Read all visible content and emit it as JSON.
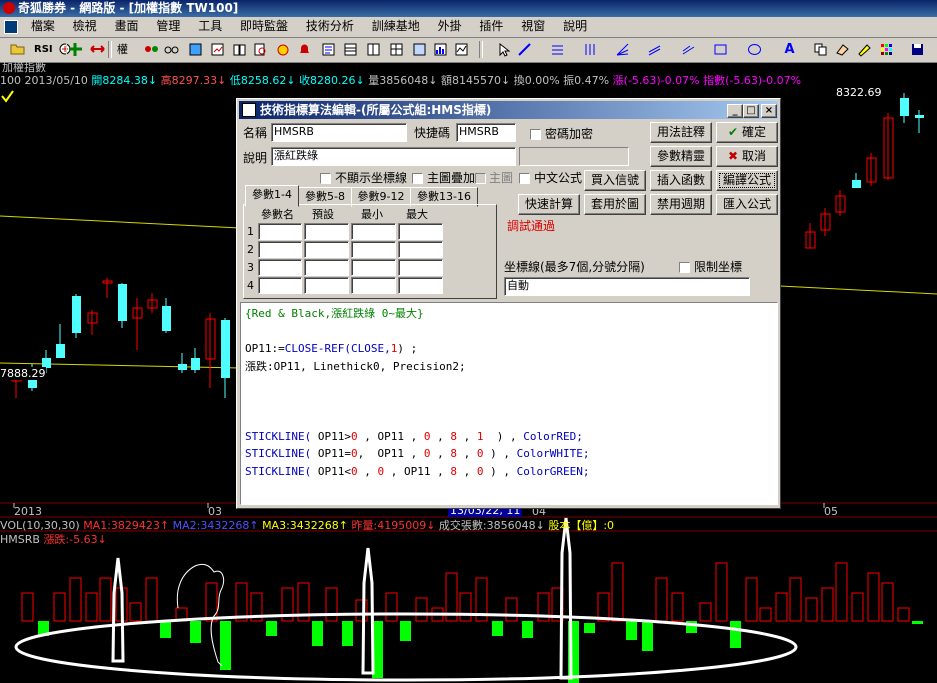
{
  "titlebar": {
    "title": "奇狐勝券 - 網路版 - [加權指數 TW100]"
  },
  "menu": {
    "items": [
      "檔案",
      "檢視",
      "畫面",
      "管理",
      "工具",
      "即時監盤",
      "技術分析",
      "訓練基地",
      "外掛",
      "插件",
      "視窗",
      "說明"
    ]
  },
  "toolbar": {
    "rsi_label": "RSI",
    "quan_label": "權"
  },
  "chart": {
    "title": "加權指數",
    "info": {
      "code": "100",
      "date": "2013/05/10",
      "open": "開8284.38↓",
      "high": "高8297.33↓",
      "low": "低8258.62↓",
      "close": "收8280.26↓",
      "volume": "量3856048↓",
      "amount": "額8145570↓",
      "turnover": "換0.00%",
      "amplitude": "振0.47%",
      "change": "漲(-5.63)-0.07%",
      "index": "指數(-5.63)-0.07%"
    },
    "price_label_high": "8322.69",
    "price_label_low": "7888.29",
    "date_labels": [
      "2013",
      "03",
      "04",
      "05"
    ],
    "cursor_label": "13/03/22, 11"
  },
  "vol_legend": {
    "name": "VOL(10,30,30)",
    "ma1": "MA1:3829423↑",
    "ma2": "MA2:3432268↑",
    "ma3": "MA3:3432268↑",
    "prev": "昨量:4195009↓",
    "deal": "成交張數:3856048↓",
    "share": "股本【億】:0"
  },
  "hms_legend": {
    "name": "HMSRB",
    "value": "漲跌:-5.63↓"
  },
  "dialog": {
    "title": "技術指標算法編輯-(所屬公式組:HMS指標)",
    "name_label": "名稱",
    "name_value": "HMSRB",
    "shortcut_label": "快捷碼",
    "shortcut_value": "HMSRB",
    "password_label": "密碼加密",
    "desc_label": "說明",
    "desc_value": "漲紅跌綠",
    "opt_no_axis": "不顯示坐標線",
    "opt_main_overlay": "主圖疊加",
    "opt_main": "主圖",
    "opt_chinese": "中文公式",
    "btn_usage": "用法註釋",
    "btn_ok": "確定",
    "btn_param_tune": "參數精靈",
    "btn_cancel": "取消",
    "btn_buy_signal": "買入信號",
    "btn_insert_func": "插入函數",
    "btn_compile": "編譯公式",
    "btn_quick_calc": "快速計算",
    "btn_apply_chart": "套用於圖",
    "btn_disable_period": "禁用週期",
    "btn_import": "匯入公式",
    "tabs": [
      "參數1-4",
      "參數5-8",
      "參數9-12",
      "參數13-16"
    ],
    "param_headers": [
      "參數名",
      "預設",
      "最小",
      "最大"
    ],
    "param_rows": [
      "1",
      "2",
      "3",
      "4"
    ],
    "status_text": "調試通過",
    "axis_label": "坐標線(最多7個,分號分隔)",
    "limit_label": "限制坐標",
    "axis_value": "自動",
    "code_lines": [
      [
        {
          "t": "{Red & Black,漲紅跌綠 0~最大}",
          "c": "green"
        }
      ],
      [
        {
          "t": "",
          "c": "black"
        }
      ],
      [
        {
          "t": "OP11:=",
          "c": "black"
        },
        {
          "t": "CLOSE-REF(CLOSE,",
          "c": "blue"
        },
        {
          "t": "1",
          "c": "red"
        },
        {
          "t": ") ;",
          "c": "black"
        }
      ],
      [
        {
          "t": "漲跌:OP11, Linethick0, Precision2;",
          "c": "black"
        }
      ],
      [
        {
          "t": "",
          "c": "black"
        }
      ],
      [
        {
          "t": "",
          "c": "black"
        }
      ],
      [
        {
          "t": "",
          "c": "black"
        }
      ],
      [
        {
          "t": "STICKLINE(",
          "c": "blue"
        },
        {
          "t": " OP11>",
          "c": "black"
        },
        {
          "t": "0",
          "c": "red"
        },
        {
          "t": " , OP11 , ",
          "c": "black"
        },
        {
          "t": "0",
          "c": "red"
        },
        {
          "t": " , ",
          "c": "black"
        },
        {
          "t": "8",
          "c": "red"
        },
        {
          "t": " , ",
          "c": "black"
        },
        {
          "t": "1",
          "c": "red"
        },
        {
          "t": "  ) , ",
          "c": "black"
        },
        {
          "t": "ColorRED;",
          "c": "blue"
        }
      ],
      [
        {
          "t": "STICKLINE(",
          "c": "blue"
        },
        {
          "t": " OP11=",
          "c": "black"
        },
        {
          "t": "0",
          "c": "red"
        },
        {
          "t": ",  OP11 , ",
          "c": "black"
        },
        {
          "t": "0",
          "c": "red"
        },
        {
          "t": " , ",
          "c": "black"
        },
        {
          "t": "8",
          "c": "red"
        },
        {
          "t": " , ",
          "c": "black"
        },
        {
          "t": "0",
          "c": "red"
        },
        {
          "t": " ) , ",
          "c": "black"
        },
        {
          "t": "ColorWHITE;",
          "c": "blue"
        }
      ],
      [
        {
          "t": "STICKLINE(",
          "c": "blue"
        },
        {
          "t": " OP11<",
          "c": "black"
        },
        {
          "t": "0",
          "c": "red"
        },
        {
          "t": " , ",
          "c": "black"
        },
        {
          "t": "0",
          "c": "red"
        },
        {
          "t": " , OP11 , ",
          "c": "black"
        },
        {
          "t": "8",
          "c": "red"
        },
        {
          "t": " , ",
          "c": "black"
        },
        {
          "t": "0",
          "c": "red"
        },
        {
          "t": " ) , ",
          "c": "black"
        },
        {
          "t": "ColorGREEN;",
          "c": "blue"
        }
      ]
    ]
  },
  "colors": {
    "up": "#ff0000",
    "down": "#00ff00",
    "candle_down": "#4fffff",
    "ma_line": "#d8d800",
    "background": "#000000"
  }
}
